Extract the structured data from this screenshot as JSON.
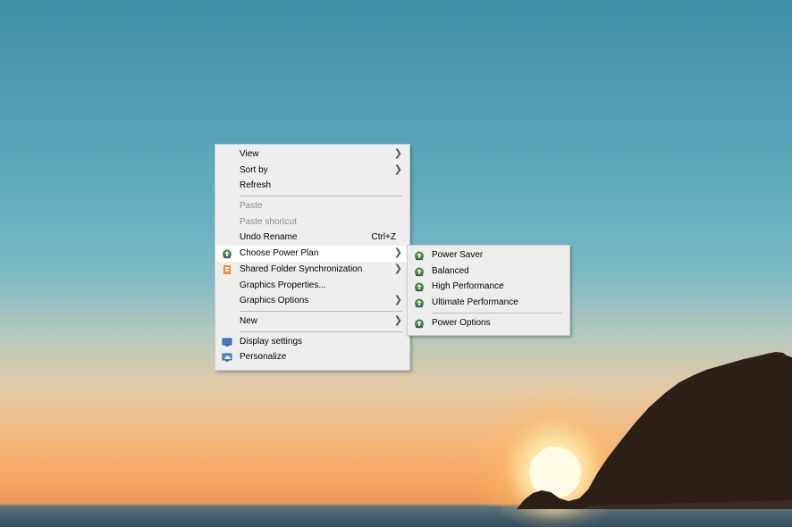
{
  "context_menu": {
    "items": [
      {
        "label": "View",
        "submenu": true
      },
      {
        "label": "Sort by",
        "submenu": true
      },
      {
        "label": "Refresh"
      },
      {
        "label": "Paste",
        "disabled": true
      },
      {
        "label": "Paste shortcut",
        "disabled": true
      },
      {
        "label": "Undo Rename",
        "shortcut": "Ctrl+Z"
      },
      {
        "label": "Choose Power Plan",
        "submenu": true,
        "icon": "power-plan-icon",
        "highlighted": true
      },
      {
        "label": "Shared Folder Synchronization",
        "submenu": true,
        "icon": "shared-folder-sync-icon"
      },
      {
        "label": "Graphics Properties..."
      },
      {
        "label": "Graphics Options",
        "submenu": true
      },
      {
        "label": "New",
        "submenu": true
      },
      {
        "label": "Display settings",
        "icon": "display-settings-icon"
      },
      {
        "label": "Personalize",
        "icon": "personalize-icon"
      }
    ]
  },
  "power_plan_submenu": {
    "items": [
      {
        "label": "Power Saver",
        "icon": "power-plan-icon"
      },
      {
        "label": "Balanced",
        "icon": "power-plan-icon"
      },
      {
        "label": "High Performance",
        "icon": "power-plan-icon"
      },
      {
        "label": "Ultimate Performance",
        "icon": "power-plan-icon"
      },
      {
        "label": "Power Options",
        "icon": "power-plan-icon"
      }
    ]
  },
  "colors": {
    "menu_background": "#eeeeee",
    "highlight": "#ffffff",
    "disabled_text": "#8d8d8d"
  }
}
